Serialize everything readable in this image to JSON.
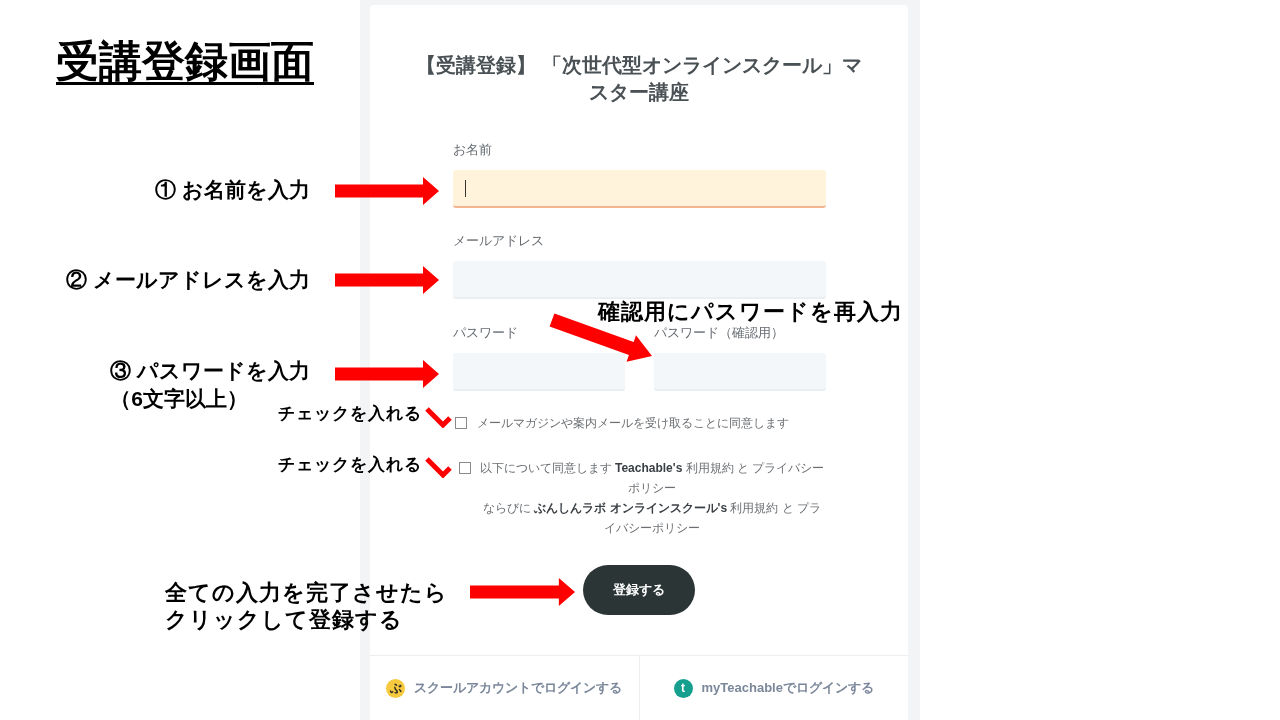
{
  "slide": {
    "title": "受講登録画面"
  },
  "form": {
    "title": "【受講登録】 「次世代型オンラインスクール」マスター講座",
    "fields": [
      {
        "label": "お名前",
        "focused": true
      },
      {
        "label": "メールアドレス",
        "focused": false
      }
    ],
    "password_fields": [
      {
        "label": "パスワード",
        "focused": false
      },
      {
        "label": "パスワード（確認用）",
        "focused": false
      }
    ],
    "checkboxes": [
      {
        "kind": "plain",
        "text": "メールマガジンや案内メールを受け取ることに同意します",
        "checked": false
      },
      {
        "kind": "terms",
        "lines": [
          "以下について同意します **Teachable's** 利用規約 と プライバシーポリシー",
          "ならびに **ぶんしんラボ オンラインスクール's** 利用規約 と プライバシーポリシー"
        ],
        "checked": false
      }
    ],
    "submit_button": "登録する",
    "login_options": [
      {
        "icon_text": "ぶ",
        "color": "#f7c93e",
        "label": "スクールアカウントでログインする"
      },
      {
        "icon_text": "t",
        "color": "#169f8e",
        "label": "myTeachableでログインする"
      }
    ]
  },
  "annotations": [
    {
      "kind": "arrow",
      "lines": [
        "① お名前を入力"
      ]
    },
    {
      "kind": "arrow",
      "lines": [
        "② メールアドレスを入力"
      ]
    },
    {
      "kind": "arrow",
      "lines": [
        "③ パスワードを入力",
        "（6文字以上）"
      ]
    },
    {
      "kind": "diagonal",
      "lines": [
        "確認用にパスワードを再入力"
      ]
    },
    {
      "kind": "tick",
      "lines": [
        "チェックを入れる"
      ]
    },
    {
      "kind": "tick",
      "lines": [
        "チェックを入れる"
      ]
    },
    {
      "kind": "arrow",
      "lines": [
        "全ての入力を完了させたら",
        "クリックして登録する"
      ]
    }
  ]
}
